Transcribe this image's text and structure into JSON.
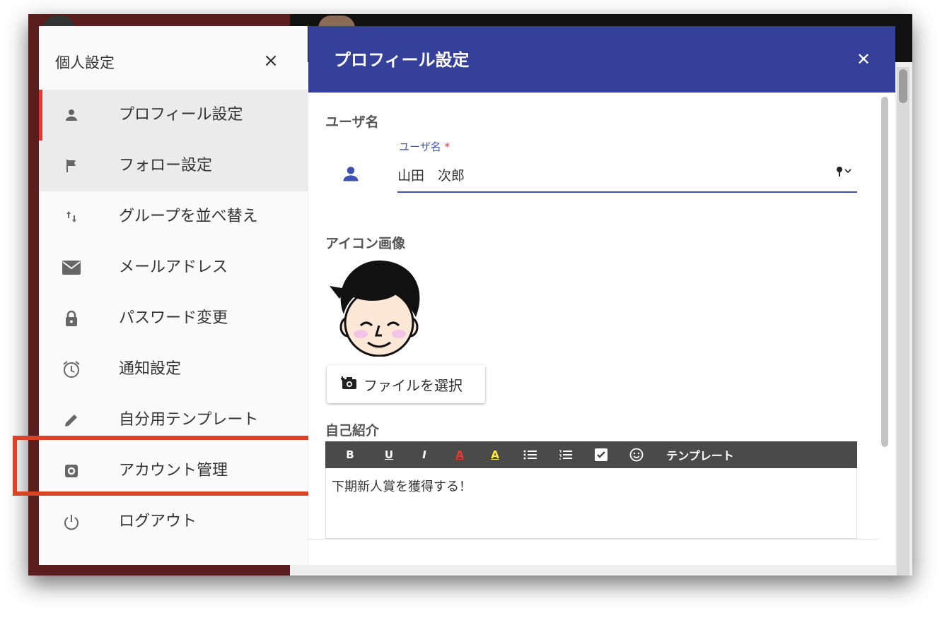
{
  "sidebar": {
    "title": "個人設定",
    "items": [
      {
        "label": "プロフィール設定",
        "icon": "person-icon"
      },
      {
        "label": "フォロー設定",
        "icon": "flag-icon"
      },
      {
        "label": "グループを並べ替え",
        "icon": "sort-arrows-icon"
      },
      {
        "label": "メールアドレス",
        "icon": "mail-icon"
      },
      {
        "label": "パスワード変更",
        "icon": "lock-icon"
      },
      {
        "label": "通知設定",
        "icon": "alarm-clock-icon"
      },
      {
        "label": "自分用テンプレート",
        "icon": "pencil-icon"
      },
      {
        "label": "アカウント管理",
        "icon": "gear-icon"
      },
      {
        "label": "ログアウト",
        "icon": "power-icon"
      }
    ]
  },
  "dialog": {
    "title": "プロフィール設定",
    "username_section": "ユーザ名",
    "username_label": "ユーザ名",
    "username_required": "*",
    "username_value": "山田　次郎",
    "icon_section": "アイコン画像",
    "file_button": "ファイルを選択",
    "intro_section": "自己紹介",
    "toolbar": {
      "bold": "B",
      "underline": "U",
      "italic": "I",
      "font_color": "A",
      "highlight": "A",
      "template": "テンプレート"
    },
    "intro_text": "下期新人賞を獲得する！"
  },
  "colors": {
    "header_bg": "#34409a",
    "accent": "#3f51b5",
    "highlight_box": "#d9432a",
    "active_marker": "#e53935"
  }
}
